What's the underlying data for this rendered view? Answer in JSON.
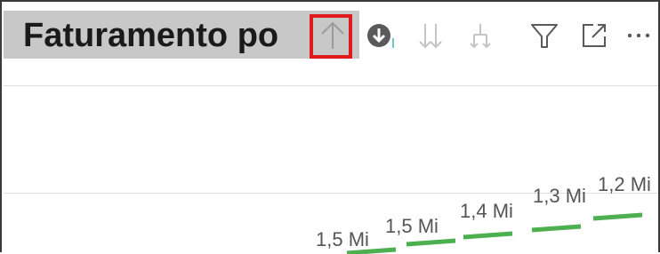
{
  "visual": {
    "title": "Faturamento po",
    "icons": {
      "drill_up": "arrow-up-icon",
      "drill_down": "arrow-down-circle-icon",
      "expand_all": "double-arrow-down-icon",
      "expand_hierarchy": "fork-down-icon",
      "filter": "filter-icon",
      "focus_mode": "focus-mode-icon",
      "more_options": "more-options-icon"
    },
    "colors": {
      "highlight": "#e11b1b",
      "bar": "#4caf50",
      "title_band": "#c8c8c8"
    }
  },
  "chart_data": {
    "type": "line",
    "labels": [
      "1,5 Mi",
      "1,5 Mi",
      "1,4 Mi",
      "1,3 Mi",
      "1,2 Mi"
    ],
    "values": [
      1.5,
      1.5,
      1.4,
      1.3,
      1.2
    ]
  }
}
